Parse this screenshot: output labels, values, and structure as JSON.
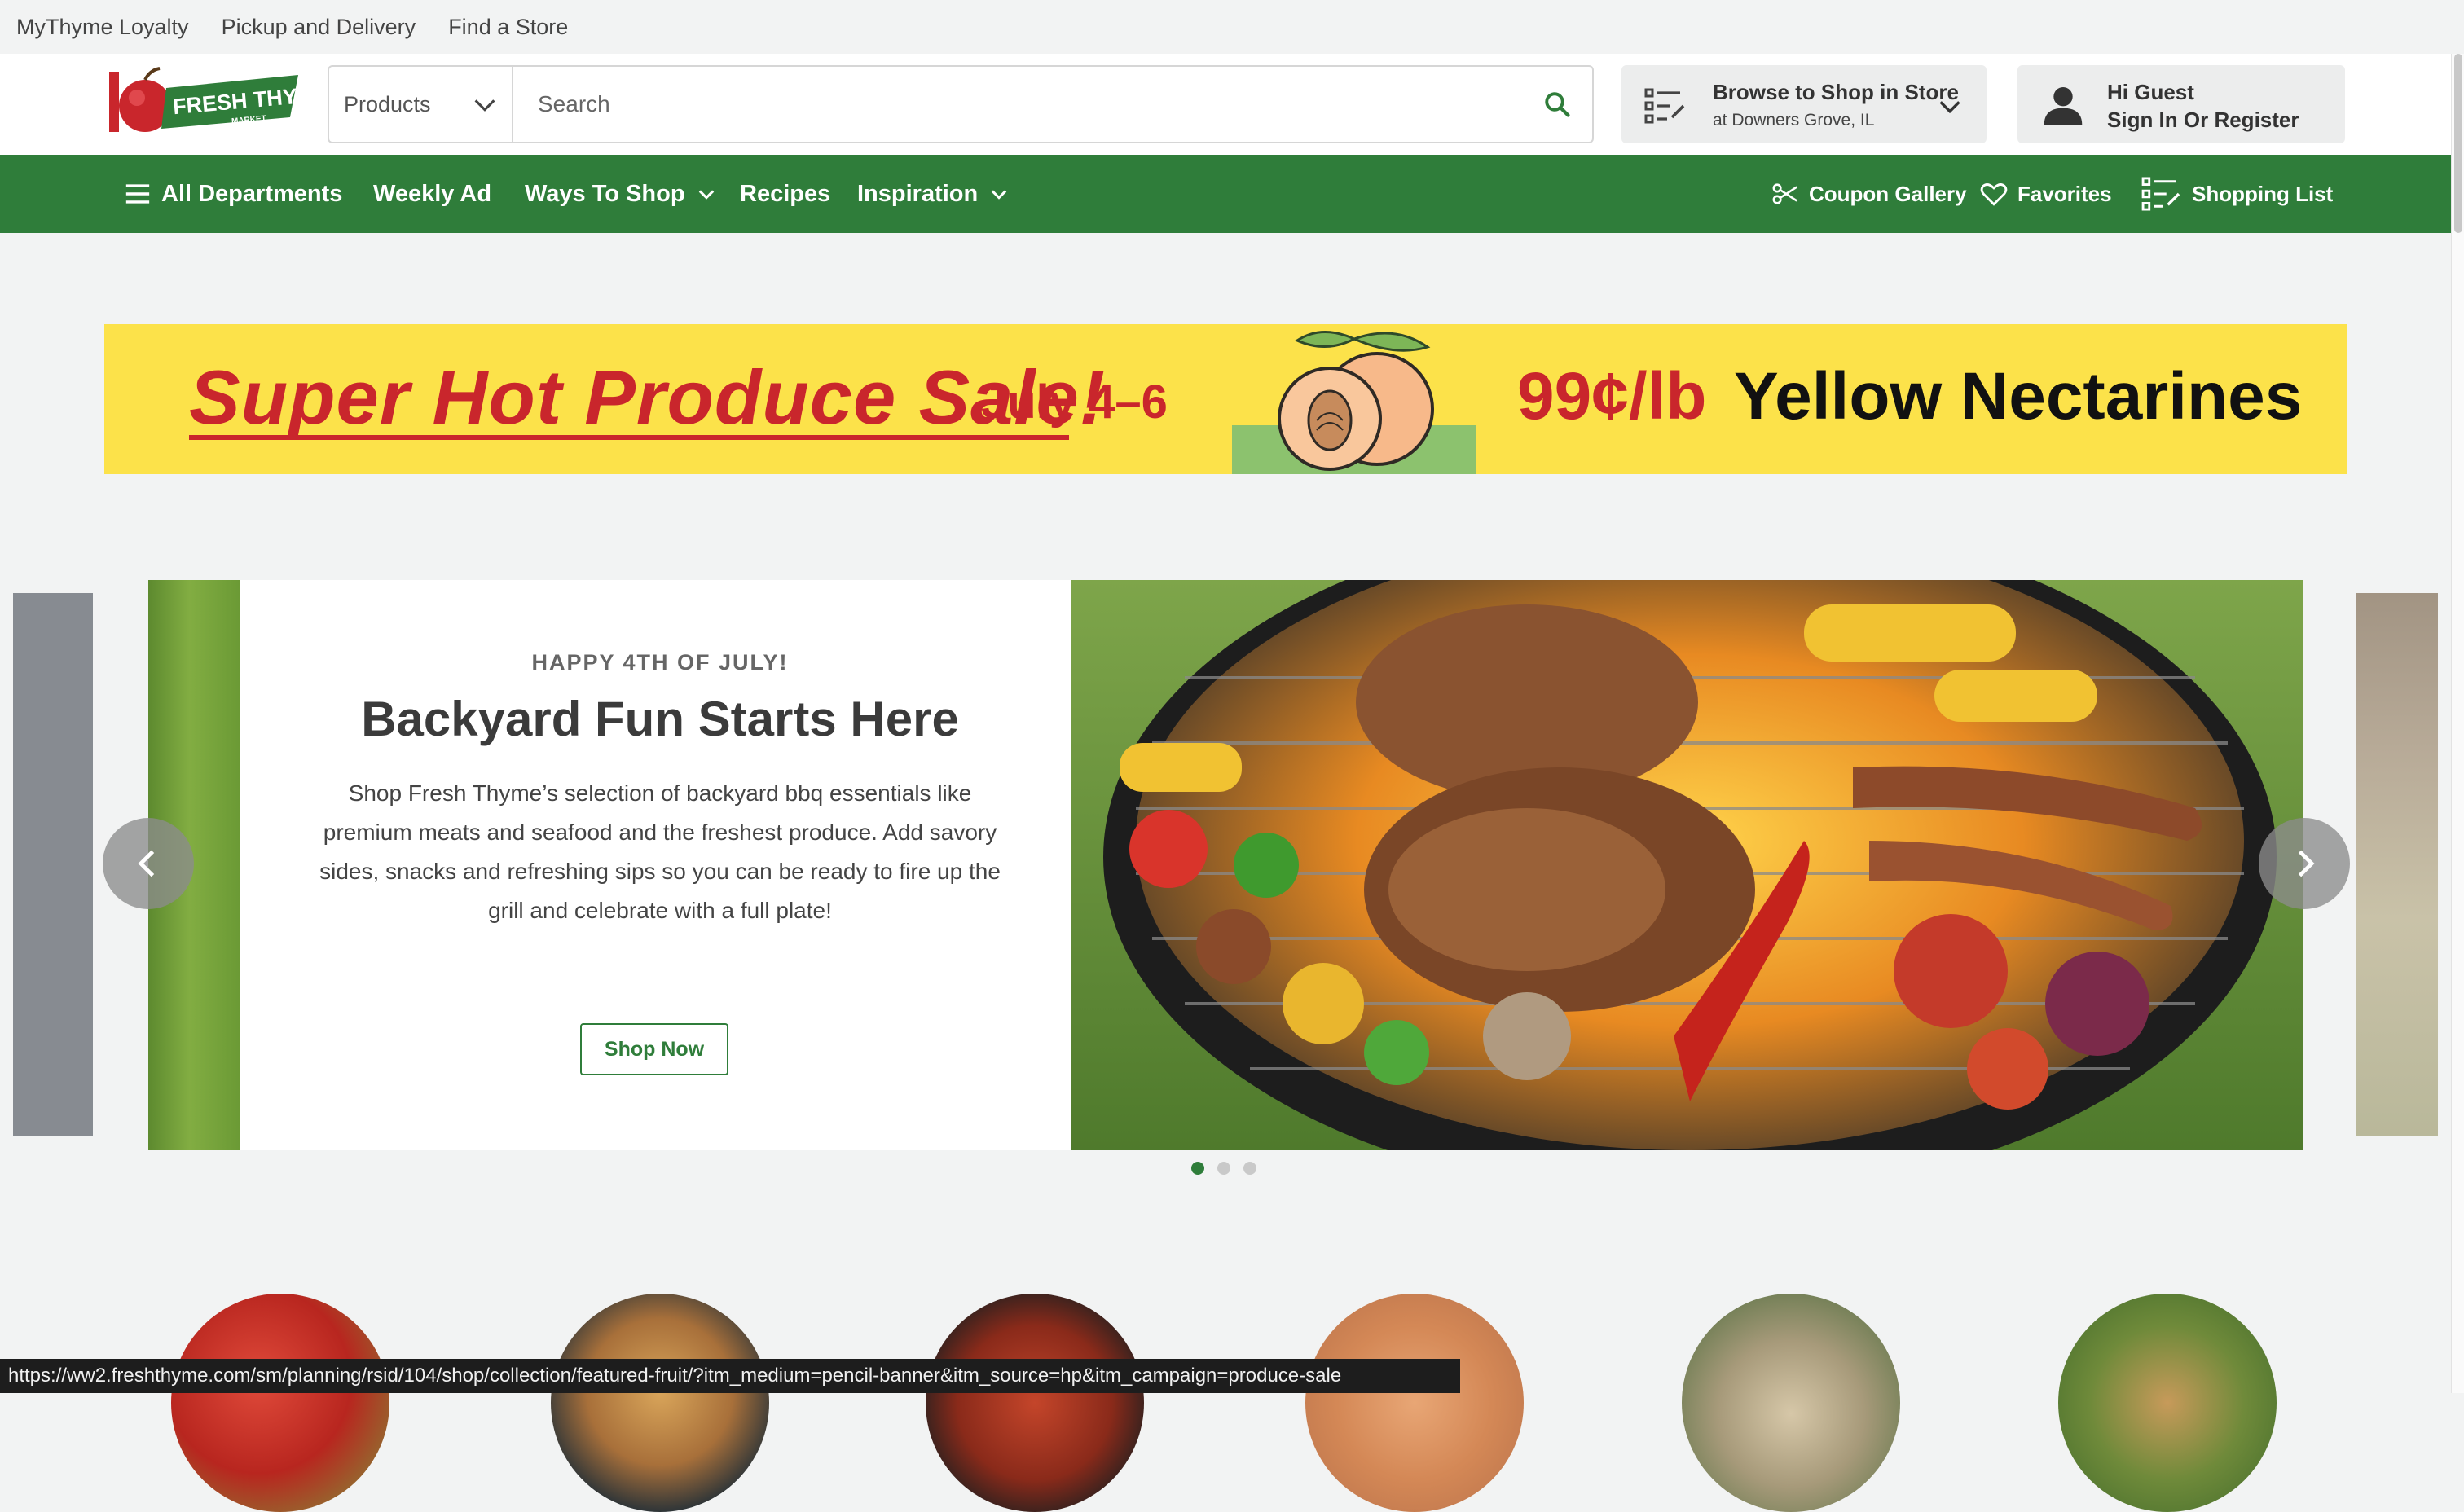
{
  "utility": {
    "links": [
      "MyThyme Loyalty",
      "Pickup and Delivery",
      "Find a Store"
    ]
  },
  "header": {
    "logo_text": "FRESH THYME",
    "logo_sub": "MARKET",
    "search_category": "Products",
    "search_placeholder": "Search",
    "store_title": "Browse to Shop in Store",
    "store_location": "at Downers Grove, IL",
    "account_greeting": "Hi Guest",
    "account_action": "Sign In Or Register"
  },
  "nav": {
    "all_departments": "All Departments",
    "weekly_ad": "Weekly Ad",
    "ways_to_shop": "Ways To Shop",
    "recipes": "Recipes",
    "inspiration": "Inspiration",
    "coupon_gallery": "Coupon Gallery",
    "favorites": "Favorites",
    "shopping_list": "Shopping List"
  },
  "promo": {
    "title": "Super Hot Produce Sale!",
    "dates": "July 4–6",
    "price": "99¢/lb",
    "product": "Yellow Nectarines"
  },
  "hero": {
    "eyebrow": "HAPPY 4TH OF JULY!",
    "title": "Backyard Fun Starts Here",
    "body": "Shop Fresh Thyme’s selection of backyard bbq essentials like premium meats and seafood and the freshest produce. Add savory sides, snacks and refreshing sips so you can be ready to fire up the grill and celebrate with a full plate!",
    "cta": "Shop Now",
    "slide_count": 3,
    "active_slide": 1
  },
  "status_url": "https://ww2.freshthyme.com/sm/planning/rsid/104/shop/collection/featured-fruit/?itm_medium=pencil-banner&itm_source=hp&itm_campaign=produce-sale",
  "colors": {
    "brand_green": "#2f7d3a",
    "promo_yellow": "#fce24a",
    "promo_red": "#c9262c"
  }
}
